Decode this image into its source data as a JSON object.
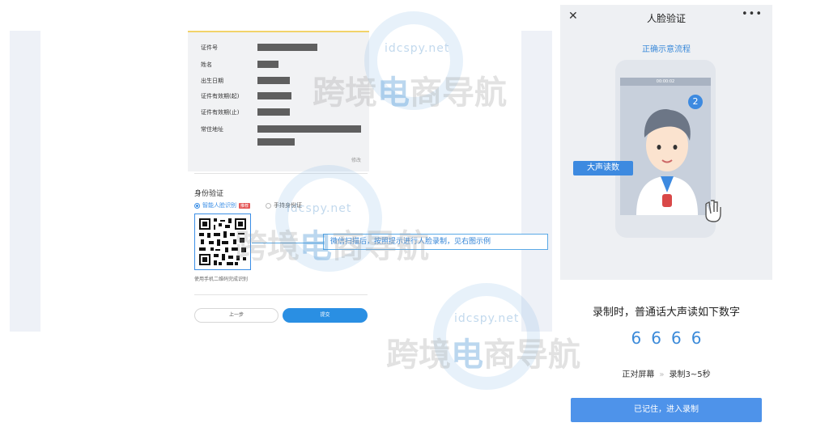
{
  "id_card": {
    "rows": [
      {
        "label": "证件号"
      },
      {
        "label": "姓名"
      },
      {
        "label": "出生日期"
      },
      {
        "label": "证件有效期(起)"
      },
      {
        "label": "证件有效期(止)"
      },
      {
        "label": "常住地址"
      }
    ],
    "edit_label": "修改"
  },
  "verify": {
    "section_title": "身份验证",
    "option_face": "智能人脸识别",
    "option_face_badge": "推荐",
    "option_hand": "手持身份证",
    "qr_caption": "使用手机二维码完成识别",
    "callout": "微信扫描后，按照提示进行人脸录制，见右图示例",
    "prev_label": "上一步",
    "submit_label": "提交"
  },
  "phone": {
    "nav_title": "人脸验证",
    "close_icon": "close-icon",
    "more_icon": "more-icon",
    "flow_title": "正确示意流程",
    "read_tag": "大声读数",
    "step_bubble": "2",
    "screen_time": "00:00:02",
    "record_title": "录制时，普通话大声读如下数字",
    "digits": [
      "6",
      "6",
      "6",
      "6"
    ],
    "tip_face": "正对屏幕",
    "tip_sep": "»",
    "tip_time": "录制3~5秒",
    "go_label": "已记住，进入录制"
  },
  "watermark": {
    "domain": "idcspy.net",
    "text_gray_1": "跨境",
    "text_blue": "电",
    "text_gray_2": "商导航"
  },
  "colors": {
    "accent": "#3b8ad9",
    "button_primary": "#2a8fe3",
    "button_go": "#4e93ea",
    "badge": "#e45757"
  }
}
